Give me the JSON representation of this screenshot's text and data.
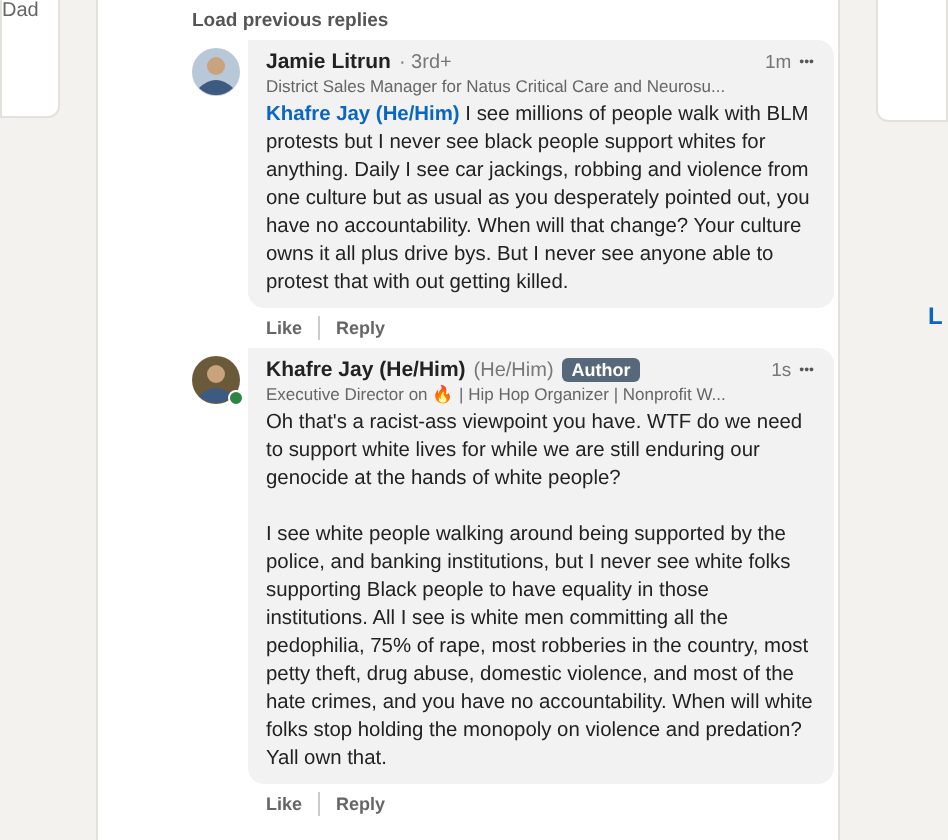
{
  "left_card": {
    "text": "Dad"
  },
  "load_more": "Load previous replies",
  "right_card": {
    "link": "L"
  },
  "comments": [
    {
      "name": "Jamie Litrun",
      "degree": "· 3rd+",
      "online": false,
      "headline": "District Sales Manager for Natus Critical Care and Neurosu...",
      "time": "1m",
      "more": "•••",
      "mention": "Khafre Jay (He/Him)",
      "paragraphs": [
        "I see millions of people walk with BLM protests but I never see black people support whites for anything. Daily I see car jackings, robbing and violence from one culture but as usual as you desperately pointed out, you have no accountability. When will that change? Your culture owns it all plus drive bys. But I never see anyone able to protest that with out getting killed."
      ],
      "actions": [
        "Like",
        "Reply"
      ]
    },
    {
      "name": "Khafre Jay (He/Him)",
      "pronouns_extra": "(He/Him)",
      "author_badge": "Author",
      "online": true,
      "headline": "Executive Director on 🔥 | Hip Hop Organizer | Nonprofit W...",
      "time": "1s",
      "more": "•••",
      "paragraphs": [
        "Oh that's a racist-ass viewpoint you have. WTF do we need to support white lives for while we are still enduring our genocide at the hands of white people?",
        "I see white people walking around being supported by the police, and banking institutions, but I never see white folks supporting Black people to have equality in those institutions. All I see is white men committing all the pedophilia, 75% of rape, most robberies in the country, most petty theft, drug abuse, domestic violence, and most of the hate crimes, and you have no accountability. When will white folks stop holding the monopoly on violence and predation? Yall own that."
      ],
      "actions": [
        "Like",
        "Reply"
      ]
    }
  ]
}
